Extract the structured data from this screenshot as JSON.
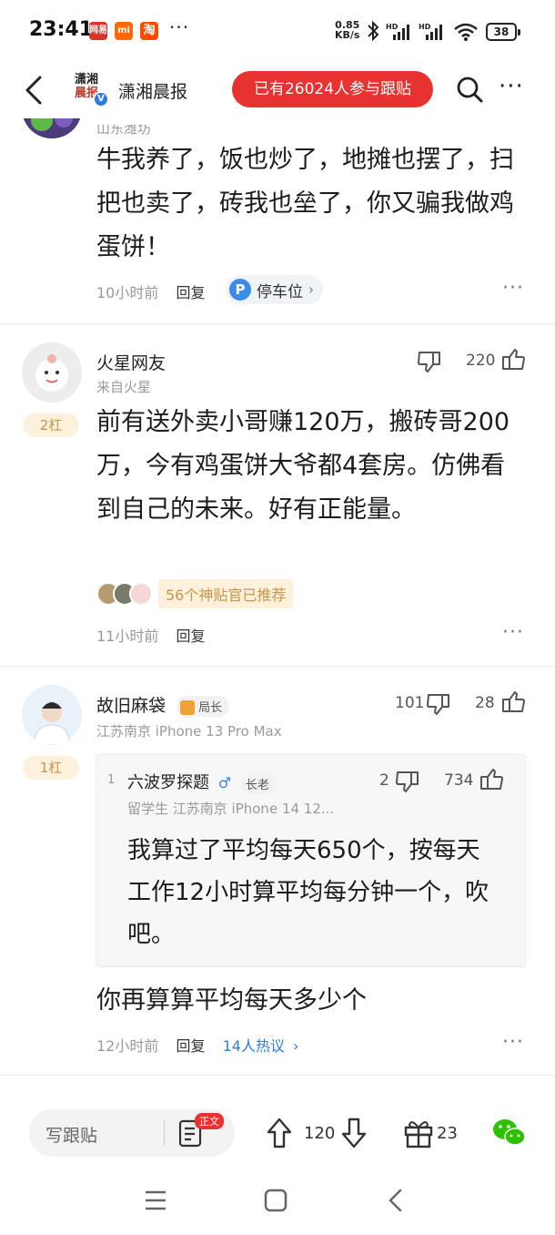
{
  "status_bar": {
    "time": "23:41",
    "app_icons": [
      "网易",
      "mi",
      "淘"
    ],
    "more": "···",
    "net_speed_value": "0.85",
    "net_speed_unit": "KB/s",
    "signal_label": "HD",
    "battery": "38"
  },
  "header": {
    "source_name": "潇湘晨报",
    "logo_text_line1": "潇湘",
    "logo_text_line2": "晨报",
    "verified_mark": "V",
    "followers_button": "已有26024人参与跟贴"
  },
  "comments": [
    {
      "location": "山东潍坊",
      "text": "牛我养了，饭也炒了，地摊也摆了，扫把也卖了，砖我也垒了，你又骗我做鸡蛋饼！",
      "time": "10小时前",
      "reply": "回复",
      "tag_icon": "P",
      "tag": "停车位"
    },
    {
      "username": "火星网友",
      "location": "来自火星",
      "floor": "2杠",
      "likes": "220",
      "text": "前有送外卖小哥赚120万，搬砖哥200万，今有鸡蛋饼大爷都4套房。仿佛看到自己的未来。好有正能量。",
      "recommend": "56个神贴官已推荐",
      "time": "11小时前",
      "reply": "回复"
    },
    {
      "username": "故旧麻袋",
      "badge": "局长",
      "location": "江苏南京  iPhone 13 Pro Max",
      "floor": "1杠",
      "dislikes": "101",
      "likes": "28",
      "quote": {
        "index": "1",
        "username": "六波罗探题",
        "badge": "长老",
        "meta": "留学生  江苏南京  iPhone 14  12...",
        "dislikes": "2",
        "likes": "734",
        "text": "我算过了平均每天650个，按每天工作12小时算平均每分钟一个，吹吧。"
      },
      "text": "你再算算平均每天多少个",
      "time": "12小时前",
      "reply": "回复",
      "hot": "14人热议"
    }
  ],
  "bottom_bar": {
    "write_placeholder": "写跟贴",
    "body_badge": "正文",
    "upvotes": "120",
    "gifts": "23"
  }
}
